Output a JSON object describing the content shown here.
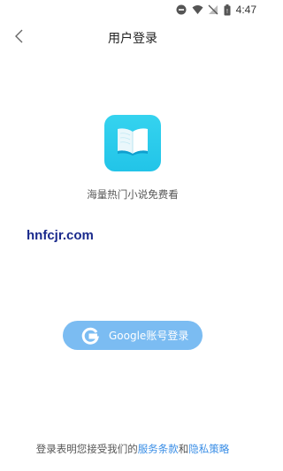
{
  "status_bar": {
    "time": "4:47",
    "icons": [
      "do-not-disturb-icon",
      "wifi-icon",
      "no-signal-icon",
      "battery-icon"
    ]
  },
  "header": {
    "title": "用户登录",
    "back_icon": "chevron-left-icon"
  },
  "brand": {
    "logo_icon": "open-book-icon",
    "logo_color": "#2ccbee",
    "tagline": "海量热门小说免费看",
    "watermark": "hnfcjr.com"
  },
  "login": {
    "google_button_label": "Google账号登录",
    "google_icon": "google-g-icon",
    "button_color": "#7bbcf2"
  },
  "agreement": {
    "prefix": "登录表明您接受我们的",
    "terms_link": "服务条款",
    "conjunction": "和",
    "privacy_link": "隐私策略",
    "link_color": "#3a8ee6"
  }
}
